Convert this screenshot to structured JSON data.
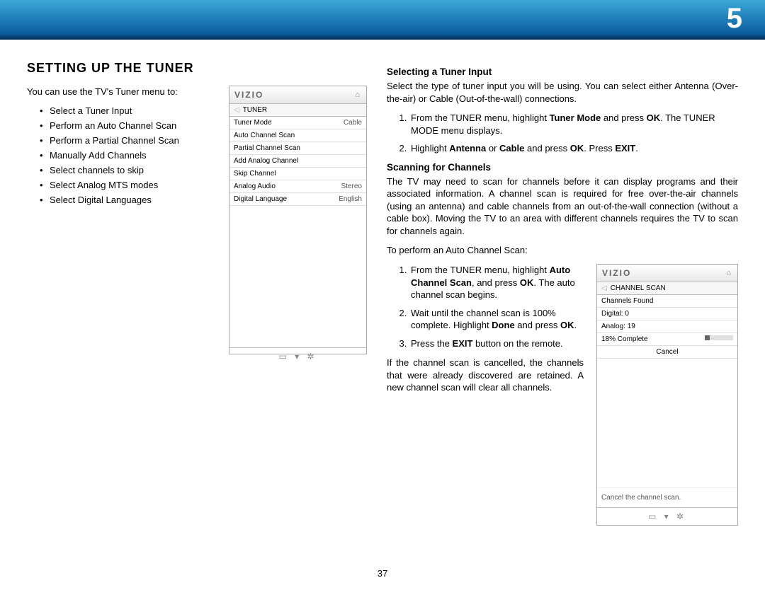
{
  "chapter": "5",
  "page_number": "37",
  "left": {
    "heading": "Setting Up the Tuner",
    "intro": "You can use the TV's Tuner menu to:",
    "bullets": [
      "Select a Tuner Input",
      "Perform an Auto Channel Scan",
      "Perform a Partial Channel Scan",
      "Manually Add Channels",
      "Select channels to skip",
      "Select Analog MTS modes",
      "Select Digital Languages"
    ]
  },
  "screenshot1": {
    "brand": "VIZIO",
    "home_icon": "⌂",
    "back_icon": "◁",
    "title": "TUNER",
    "rows": [
      {
        "label": "Tuner Mode",
        "value": "Cable"
      },
      {
        "label": "Auto Channel Scan",
        "value": ""
      },
      {
        "label": "Partial Channel Scan",
        "value": ""
      },
      {
        "label": "Add Analog Channel",
        "value": ""
      },
      {
        "label": "Skip Channel",
        "value": ""
      },
      {
        "label": "Analog Audio",
        "value": "Stereo"
      },
      {
        "label": "Digital Language",
        "value": "English"
      }
    ],
    "footer_icons": "▭  ▾  ✲"
  },
  "right": {
    "sec1_title": "Selecting a Tuner Input",
    "sec1_p1": "Select the type of tuner input you will be using. You can select either Antenna (Over-the-air) or Cable (Out-of-the-wall) connections.",
    "sec1_step1_a": "From the TUNER menu, highlight ",
    "sec1_step1_b": "Tuner Mode",
    "sec1_step1_c": " and press ",
    "sec1_step1_d": "OK",
    "sec1_step1_e": ". The TUNER MODE menu displays.",
    "sec1_step2_a": "Highlight ",
    "sec1_step2_b": "Antenna",
    "sec1_step2_c": " or ",
    "sec1_step2_d": "Cable",
    "sec1_step2_e": " and press ",
    "sec1_step2_f": "OK",
    "sec1_step2_g": ". Press ",
    "sec1_step2_h": "EXIT",
    "sec1_step2_i": ".",
    "sec2_title": "Scanning for Channels",
    "sec2_p1": "The TV may need to scan for channels before it can display programs and their associated information. A channel scan is required for free over-the-air channels (using an antenna) and cable channels from an out-of-the-wall connection (without a cable box). Moving the TV to an area with different channels requires the TV to scan for channels again.",
    "sec2_p2": "To perform an Auto Channel Scan:",
    "sec2_step1_a": "From the TUNER menu, highlight ",
    "sec2_step1_b": "Auto Channel Scan",
    "sec2_step1_c": ", and press ",
    "sec2_step1_d": "OK",
    "sec2_step1_e": ". The auto channel scan begins.",
    "sec2_step2_a": "Wait until the channel scan is 100% complete. Highlight ",
    "sec2_step2_b": "Done",
    "sec2_step2_c": " and press ",
    "sec2_step2_d": "OK",
    "sec2_step2_e": ".",
    "sec2_step3_a": "Press the ",
    "sec2_step3_b": "EXIT",
    "sec2_step3_c": " button on the remote.",
    "sec2_p3": "If the channel scan is cancelled, the channels that were already discovered are retained. A new channel scan will clear all channels."
  },
  "screenshot2": {
    "brand": "VIZIO",
    "home_icon": "⌂",
    "back_icon": "◁",
    "title": "CHANNEL SCAN",
    "rows": [
      {
        "label": "Channels Found",
        "value": ""
      },
      {
        "label": "Digital:   0",
        "value": ""
      },
      {
        "label": "Analog: 19",
        "value": ""
      }
    ],
    "progress_label": "18%   Complete",
    "progress_pct": 18,
    "cancel": "Cancel",
    "note": "Cancel the channel scan.",
    "footer_icons": "▭  ▾  ✲"
  }
}
